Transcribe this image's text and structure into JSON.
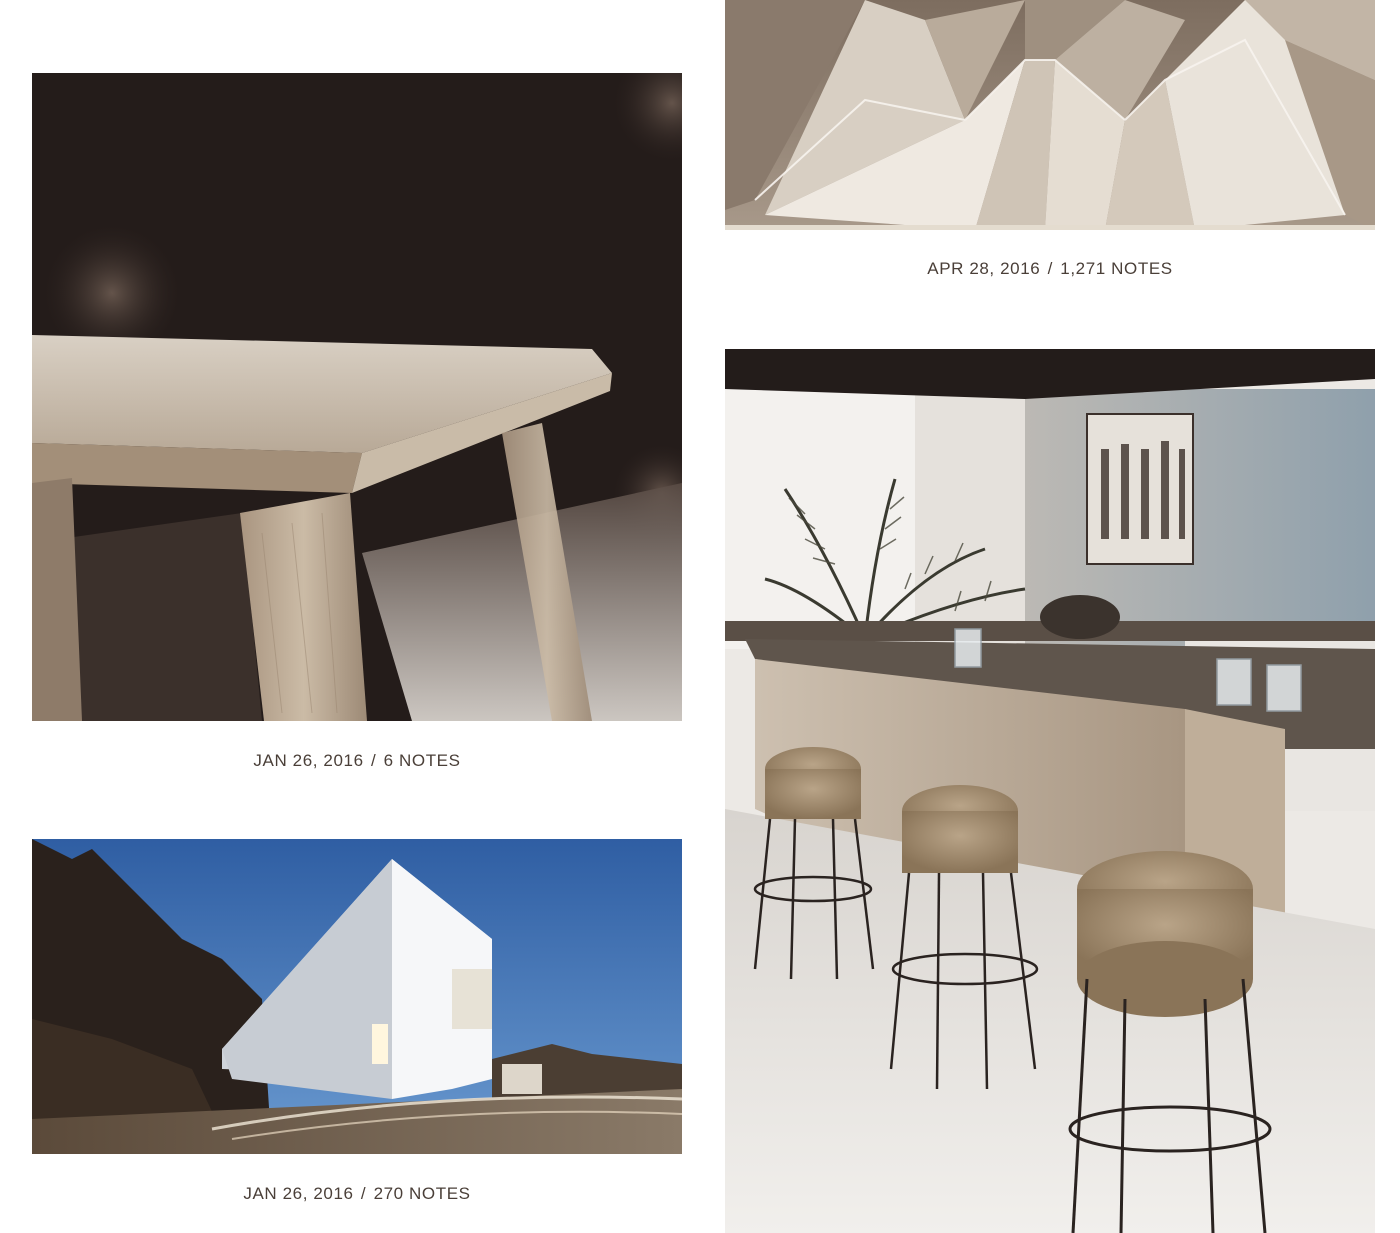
{
  "posts": [
    {
      "id": "table-post",
      "image_subject": "close-up of a light oak table corner with legs against a dark background",
      "date": "JAN 26, 2016",
      "separator": "/",
      "notes": "6 NOTES"
    },
    {
      "id": "house-post",
      "image_subject": "white modern cubic house at dusk with blue sky",
      "date": "JAN 26, 2016",
      "separator": "/",
      "notes": "270 NOTES"
    },
    {
      "id": "origami-post",
      "image_subject": "folded beige origami pendant lamp shade",
      "date": "APR 28, 2016",
      "separator": "/",
      "notes": "1,271 NOTES"
    },
    {
      "id": "kitchen-post",
      "image_subject": "kitchen island with three cork-top bar stools, palm plant and painting",
      "date": "",
      "separator": "",
      "notes": ""
    }
  ],
  "colors": {
    "text": "#4a3f38",
    "background": "#ffffff",
    "sky": "#4f86c0",
    "dark": "#241c1a"
  }
}
